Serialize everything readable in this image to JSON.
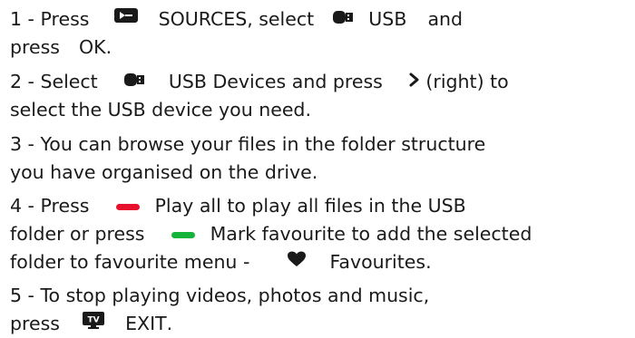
{
  "steps": [
    {
      "lines": [
        {
          "segments": [
            {
              "text": "1 - Press"
            },
            {
              "icon": "sources-icon"
            },
            {
              "text": "SOURCES",
              "kw": true
            },
            {
              "text": ", select"
            },
            {
              "icon": "usb-icon"
            },
            {
              "text": "USB",
              "kw": true
            },
            {
              "text": "and"
            }
          ]
        },
        {
          "segments": [
            {
              "text": "press"
            },
            {
              "text": "OK",
              "kw": true
            },
            {
              "text": "."
            }
          ]
        }
      ]
    },
    {
      "lines": [
        {
          "segments": [
            {
              "text": "2 - Select"
            },
            {
              "icon": "usb-icon"
            },
            {
              "text": "USB Devices",
              "kw": true
            },
            {
              "text": "and press"
            },
            {
              "icon": "chevron-right-icon"
            },
            {
              "text": "(right) to"
            }
          ]
        },
        {
          "segments": [
            {
              "text": "select the USB device you need."
            }
          ]
        }
      ]
    },
    {
      "lines": [
        {
          "segments": [
            {
              "text": "3 - You can browse your files in the folder structure"
            }
          ]
        },
        {
          "segments": [
            {
              "text": "you have organised on the drive."
            }
          ]
        }
      ]
    },
    {
      "lines": [
        {
          "segments": [
            {
              "text": "4 - Press"
            },
            {
              "icon": "red-key-icon"
            },
            {
              "text": "Play all",
              "kw": true
            },
            {
              "text": "to play all files in the USB"
            }
          ]
        },
        {
          "segments": [
            {
              "text": "folder or press"
            },
            {
              "icon": "green-key-icon"
            },
            {
              "text": "Mark favourite",
              "kw": true
            },
            {
              "text": "to add the selected"
            }
          ]
        },
        {
          "segments": [
            {
              "text": "folder to favourite menu -"
            },
            {
              "icon": "heart-icon"
            },
            {
              "text": "Favourites",
              "kw": true
            },
            {
              "text": "."
            }
          ]
        }
      ]
    },
    {
      "lines": [
        {
          "segments": [
            {
              "text": "5 - To stop playing videos, photos and music,"
            }
          ]
        },
        {
          "segments": [
            {
              "text": "press"
            },
            {
              "icon": "tv-icon"
            },
            {
              "text": "EXIT",
              "kw": true
            },
            {
              "text": "."
            }
          ]
        }
      ]
    }
  ]
}
